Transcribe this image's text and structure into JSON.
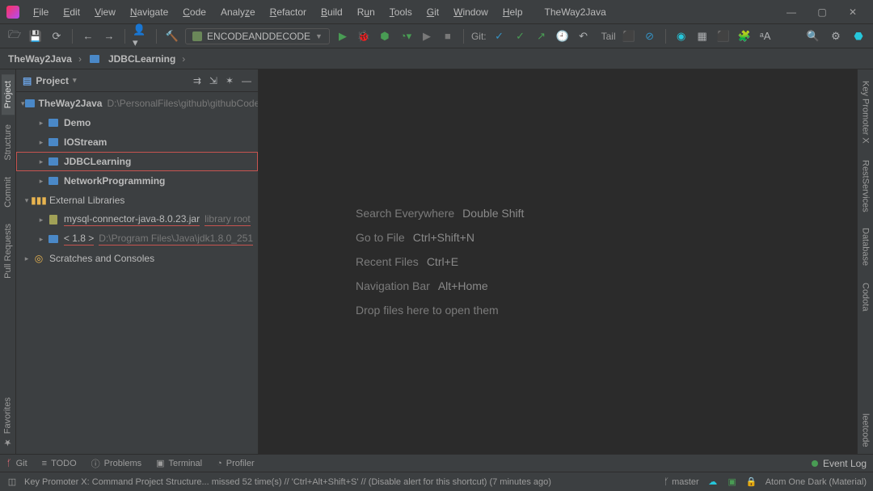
{
  "app": {
    "project_title": "TheWay2Java"
  },
  "menu": [
    "File",
    "Edit",
    "View",
    "Navigate",
    "Code",
    "Analyze",
    "Refactor",
    "Build",
    "Run",
    "Tools",
    "Git",
    "Window",
    "Help"
  ],
  "toolbar": {
    "run_config": "ENCODEANDDECODE",
    "git_label": "Git:"
  },
  "breadcrumb": {
    "root": "TheWay2Java",
    "module": "JDBCLearning"
  },
  "panel": {
    "title": "Project"
  },
  "tree": {
    "root": {
      "name": "TheWay2Java",
      "path": "D:\\PersonalFiles\\github\\githubCode"
    },
    "modules": [
      "Demo",
      "IOStream",
      "JDBCLearning",
      "NetworkProgramming"
    ],
    "ext_lib_label": "External Libraries",
    "libs": [
      {
        "name": "mysql-connector-java-8.0.23.jar",
        "suffix": "library root"
      },
      {
        "name": "< 1.8 >",
        "suffix": "D:\\Program Files\\Java\\jdk1.8.0_251"
      }
    ],
    "scratches": "Scratches and Consoles"
  },
  "hints": [
    {
      "action": "Search Everywhere",
      "key": "Double Shift"
    },
    {
      "action": "Go to File",
      "key": "Ctrl+Shift+N"
    },
    {
      "action": "Recent Files",
      "key": "Ctrl+E"
    },
    {
      "action": "Navigation Bar",
      "key": "Alt+Home"
    },
    {
      "action": "Drop files here to open them",
      "key": ""
    }
  ],
  "left_tabs": [
    "Project",
    "Structure",
    "Commit",
    "Pull Requests",
    "Favorites"
  ],
  "right_tabs": [
    "Key Promoter X",
    "RestServices",
    "Database",
    "Codota",
    "leetcode"
  ],
  "bottom_tabs": {
    "git": "Git",
    "todo": "TODO",
    "problems": "Problems",
    "terminal": "Terminal",
    "profiler": "Profiler",
    "event_log": "Event Log"
  },
  "status": {
    "message": "Key Promoter X: Command Project Structure... missed 52 time(s) // 'Ctrl+Alt+Shift+S' // (Disable alert for this shortcut) (7 minutes ago)",
    "branch": "master",
    "theme": "Atom One Dark (Material)"
  }
}
